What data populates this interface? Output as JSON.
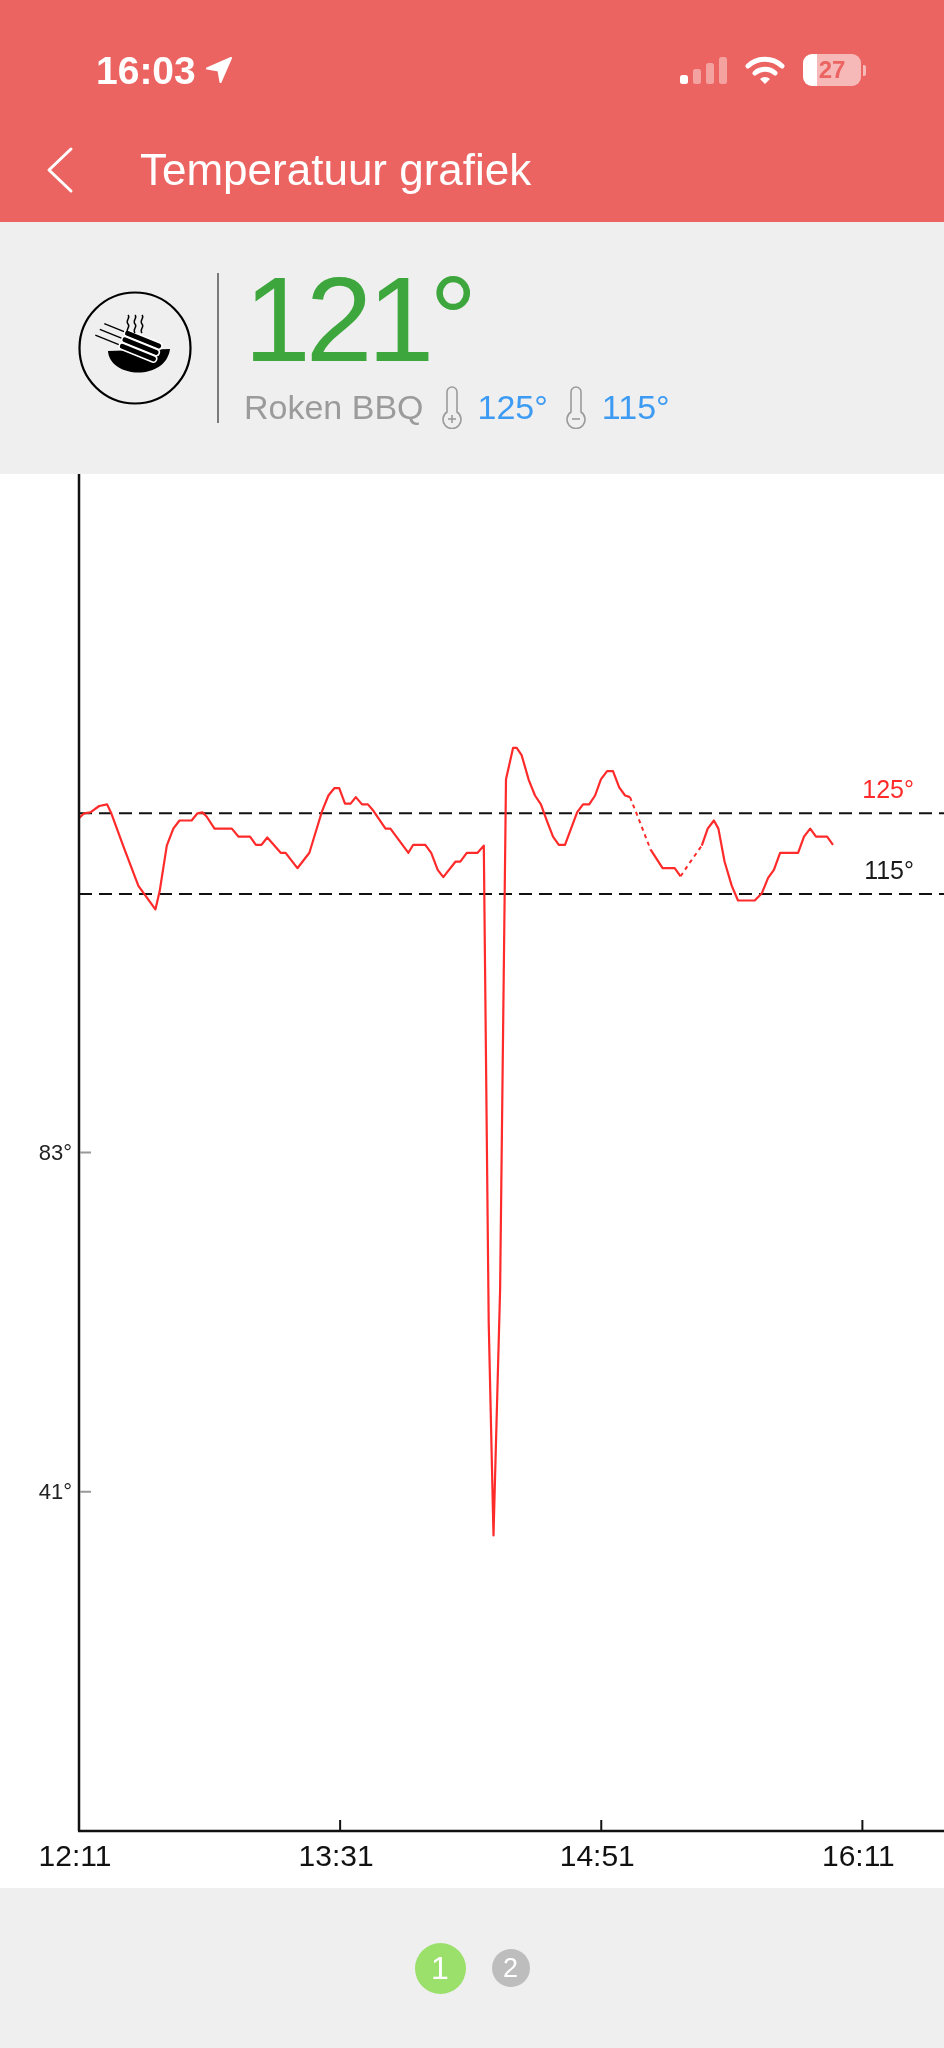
{
  "status_bar": {
    "time": "16:03",
    "battery": "27"
  },
  "nav_bar": {
    "title": "Temperatuur grafiek"
  },
  "probe": {
    "temperature": "121°",
    "program": "Roken BBQ",
    "max_temperature": "125°",
    "min_temperature": "115°"
  },
  "chart": {
    "chart_data": {
      "type": "line",
      "x": [
        731,
        732.6,
        734.5,
        737.2,
        739.6,
        740.9,
        744.6,
        749.2,
        754.4,
        755.7,
        757.9,
        759.9,
        761.8,
        765.5,
        767.3,
        768.8,
        770.1,
        772.5,
        777.8,
        779.9,
        783.4,
        785.2,
        786.9,
        788.7,
        792.8,
        794.3,
        797.9,
        801.6,
        803.3,
        805.5,
        807.4,
        809.2,
        810.7,
        812.5,
        814.2,
        815.8,
        817.7,
        819.5,
        821.2,
        824.9,
        826.4,
        831.9,
        833.4,
        837.1,
        838.9,
        840.9,
        842.6,
        846.3,
        847.8,
        849.8,
        853.1,
        855,
        856.5,
        858,
        860,
        861.8,
        864,
        865.1,
        866.6,
        868.8,
        870.7,
        872.5,
        874.4,
        876.2,
        878,
        879.9,
        883.6,
        885.4,
        887.3,
        889.1,
        890.9,
        892.8,
        894.6,
        896.5,
        898.3,
        899.8,
        903,
        906.1,
        909.8,
        913.5,
        915.3,
        918.5,
        921.8,
        923.6,
        925.5,
        926.9,
        928.8,
        931,
        932.9,
        938,
        940.2,
        942.1,
        943.9,
        945.8,
        951.3,
        953.1,
        955,
        956.8,
        960.2,
        962
      ],
      "series": [
        {
          "color": "#ff2a2a",
          "values": [
            124.4,
            125,
            125.1,
            125.9,
            126.1,
            125,
            120.9,
            116,
            113.1,
            115.3,
            121,
            123.1,
            124.1,
            124.1,
            125,
            125.1,
            124.6,
            123.1,
            123.1,
            122.1,
            122.1,
            121.1,
            121.1,
            122,
            120.1,
            120.1,
            118.2,
            120.1,
            122.4,
            125.3,
            127.2,
            128.1,
            128.1,
            126.2,
            126.2,
            127,
            126.1,
            126.1,
            125.3,
            123.1,
            123.1,
            120.1,
            121.1,
            121.1,
            120.1,
            118,
            117.1,
            119,
            119,
            120.1,
            120.1,
            121,
            62,
            35.6,
            66,
            129.2,
            133.1,
            133.1,
            132.2,
            129.1,
            127.2,
            126.1,
            124,
            122.1,
            121.1,
            121.1,
            125.1,
            126.1,
            126.1,
            127.2,
            129.2,
            130.2,
            130.2,
            128.2,
            127.2,
            127,
            null,
            120.5,
            118.2,
            118.2,
            117.2,
            null,
            121,
            123.1,
            124.1,
            123.1,
            119,
            116,
            114.2,
            114.2,
            115.1,
            117,
            118,
            120.1,
            120.1,
            122.1,
            123.1,
            122.1,
            122.1,
            121.1
          ]
        }
      ],
      "xlim": [
        731,
        996
      ],
      "ylim": [
        -1,
        167
      ],
      "xticks": [
        {
          "value": 731,
          "label": "12:11"
        },
        {
          "value": 811,
          "label": "13:31"
        },
        {
          "value": 891,
          "label": "14:51"
        },
        {
          "value": 971,
          "label": "16:11"
        }
      ],
      "yticks": [
        {
          "value": 41,
          "label": "41°"
        },
        {
          "value": 83,
          "label": "83°"
        }
      ],
      "ref_lines": [
        {
          "axis": "y",
          "value": 125,
          "label": "125°",
          "color": "#111111"
        },
        {
          "axis": "y",
          "value": 115,
          "label": "115°",
          "color": "#111111"
        }
      ]
    },
    "threshold_labels": [
      {
        "color": "#ff2a2a"
      },
      {
        "color": "#1a1a1a"
      }
    ]
  },
  "pages": [
    {
      "label": "1",
      "selected": true
    },
    {
      "label": "2",
      "selected": false
    }
  ]
}
